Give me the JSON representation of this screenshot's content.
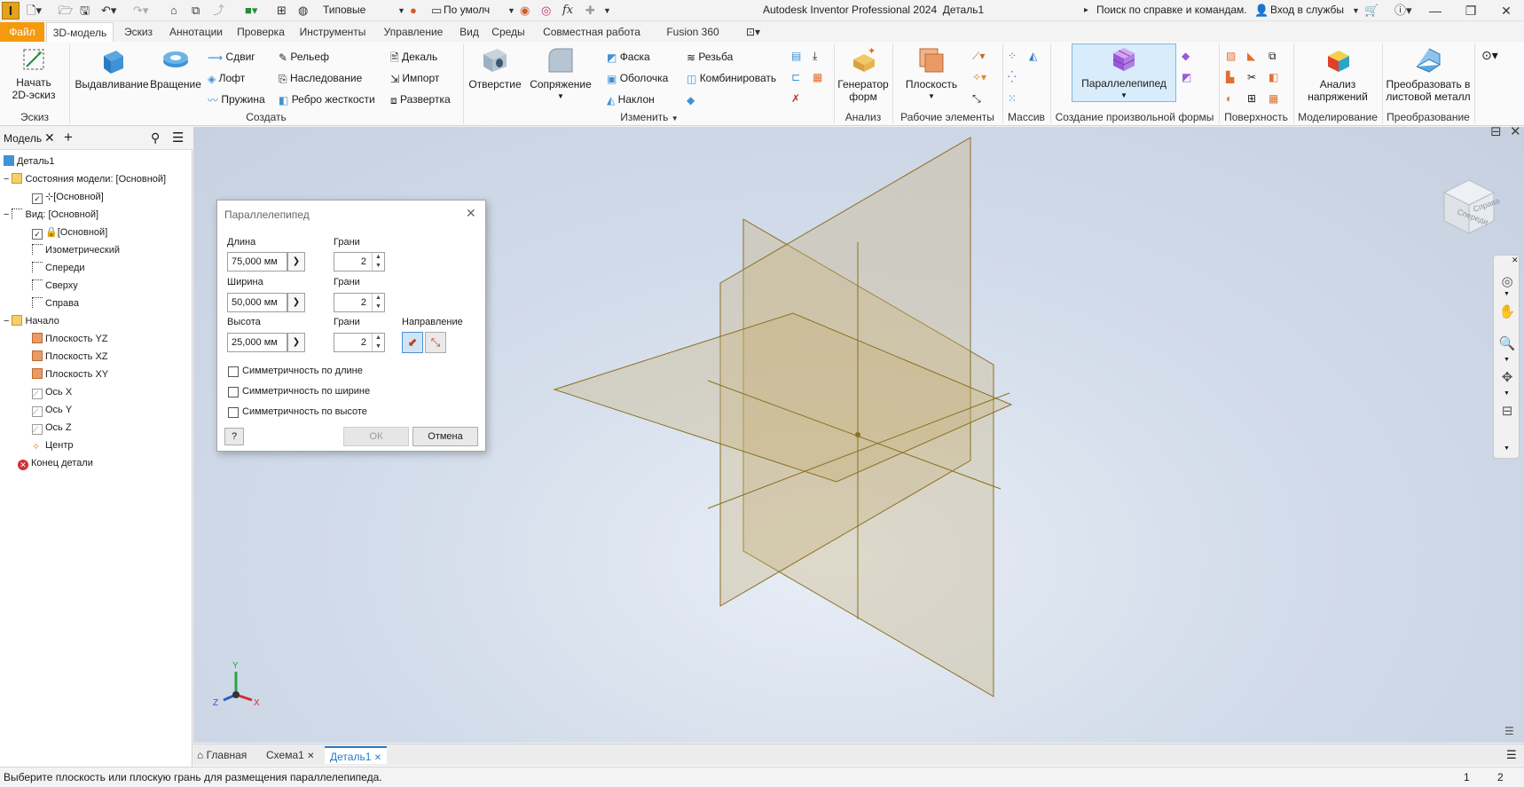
{
  "app": {
    "title": "Autodesk Inventor Professional 2024",
    "document": "Деталь1",
    "logo": "I",
    "search_placeholder": "Поиск по справке и командам...",
    "signin": "Вход в службы",
    "style_select": "Типовые",
    "appearance_select": "По умолч",
    "fx": "fx"
  },
  "tabs": [
    {
      "label": "Файл"
    },
    {
      "label": "3D-модель"
    },
    {
      "label": "Эскиз"
    },
    {
      "label": "Аннотации"
    },
    {
      "label": "Проверка"
    },
    {
      "label": "Инструменты"
    },
    {
      "label": "Управление"
    },
    {
      "label": "Вид"
    },
    {
      "label": "Среды"
    },
    {
      "label": "Совместная работа"
    },
    {
      "label": "Fusion 360"
    }
  ],
  "ribbon": {
    "sketch": {
      "start": "Начать",
      "start2": "2D-эскиз",
      "group": "Эскиз"
    },
    "create": {
      "extrude": "Выдавливание",
      "revolve": "Вращение",
      "sweep": "Сдвиг",
      "loft": "Лофт",
      "coil": "Пружина",
      "emboss": "Рельеф",
      "derive": "Наследование",
      "rib": "Ребро жесткости",
      "decal": "Декаль",
      "import": "Импорт",
      "unwrap": "Развертка",
      "group": "Создать"
    },
    "modify": {
      "hole": "Отверстие",
      "fillet": "Сопряжение",
      "chamfer": "Фаска",
      "shell": "Оболочка",
      "draft": "Наклон",
      "thread": "Резьба",
      "combine": "Комбинировать",
      "group": "Изменить"
    },
    "analysis": {
      "generator": "Генератор",
      "generator2": "форм",
      "group": "Анализ"
    },
    "work": {
      "plane": "Плоскость",
      "group": "Рабочие элементы"
    },
    "pattern": {
      "group": "Массив"
    },
    "freeform": {
      "box": "Параллелепипед",
      "group": "Создание произвольной формы"
    },
    "surface": {
      "group": "Поверхность"
    },
    "simulation": {
      "stress": "Анализ",
      "stress2": "напряжений",
      "group": "Моделирование"
    },
    "convert": {
      "sheet": "Преобразовать в",
      "sheet2": "листовой металл",
      "group": "Преобразование"
    }
  },
  "browser": {
    "tab": "Модель",
    "items": [
      {
        "label": "Деталь1"
      },
      {
        "label": "Состояния модели: [Основной]"
      },
      {
        "label": "[Основной]"
      },
      {
        "label": "Вид: [Основной]"
      },
      {
        "label": "[Основной]"
      },
      {
        "label": "Изометрический"
      },
      {
        "label": "Спереди"
      },
      {
        "label": "Сверху"
      },
      {
        "label": "Справа"
      },
      {
        "label": "Начало"
      },
      {
        "label": "Плоскость YZ"
      },
      {
        "label": "Плоскость XZ"
      },
      {
        "label": "Плоскость XY"
      },
      {
        "label": "Ось X"
      },
      {
        "label": "Ось Y"
      },
      {
        "label": "Ось Z"
      },
      {
        "label": "Центр"
      },
      {
        "label": "Конец детали"
      }
    ]
  },
  "dialog": {
    "title": "Параллелепипед",
    "length_label": "Длина",
    "length_value": "75,000 мм",
    "width_label": "Ширина",
    "width_value": "50,000 мм",
    "height_label": "Высота",
    "height_value": "25,000 мм",
    "faces_label": "Грани",
    "faces_length": "2",
    "faces_width": "2",
    "faces_height": "2",
    "direction_label": "Направление",
    "sym_length": "Симметричность по длине",
    "sym_width": "Симметричность по ширине",
    "sym_height": "Симметричность по высоте",
    "ok": "ОК",
    "cancel": "Отмена"
  },
  "viewcube": {
    "front": "Спереди",
    "right": "Справа"
  },
  "triad": {
    "x": "X",
    "y": "Y",
    "z": "Z"
  },
  "doctabs": [
    {
      "label": "Главная"
    },
    {
      "label": "Схема1"
    },
    {
      "label": "Деталь1"
    }
  ],
  "status": {
    "message": "Выберите плоскость или плоскую грань для размещения параллелепипеда.",
    "n1": "1",
    "n2": "2"
  },
  "colors": {
    "accent": "#f59a0d",
    "plane_fill": "#c9b27a",
    "plane_stroke": "#8a7020",
    "viewport": "#cfd8e6"
  }
}
